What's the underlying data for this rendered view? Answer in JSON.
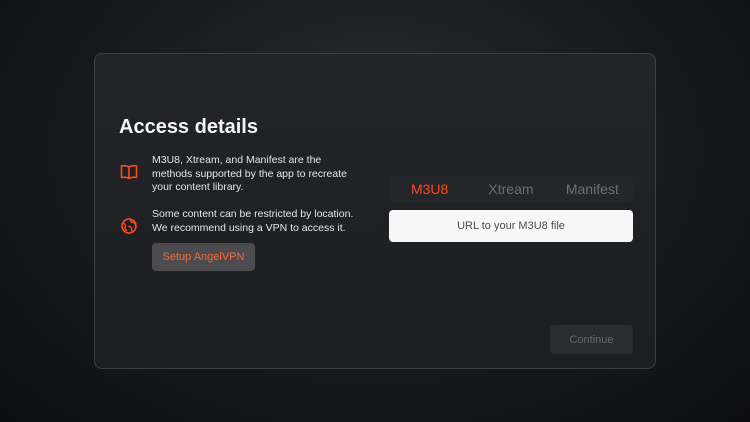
{
  "panel": {
    "title": "Access details",
    "info": [
      {
        "icon": "book-icon",
        "text": "M3U8, Xtream, and Manifest are the methods supported by the app to recreate your content library."
      },
      {
        "icon": "vpn-globe-icon",
        "text": "Some content can be restricted by location. We recommend using a VPN to access it."
      }
    ],
    "setup_button": "Setup AngelVPN",
    "tabs": [
      {
        "label": "M3U8",
        "active": true
      },
      {
        "label": "Xtream",
        "active": false
      },
      {
        "label": "Manifest",
        "active": false
      }
    ],
    "url_input": {
      "placeholder": "URL to your M3U8 file",
      "value": ""
    },
    "continue_button": "Continue"
  },
  "colors": {
    "accent": "#ff4a1f",
    "setup_text": "#f06a3a",
    "background": "#1c1e21"
  }
}
